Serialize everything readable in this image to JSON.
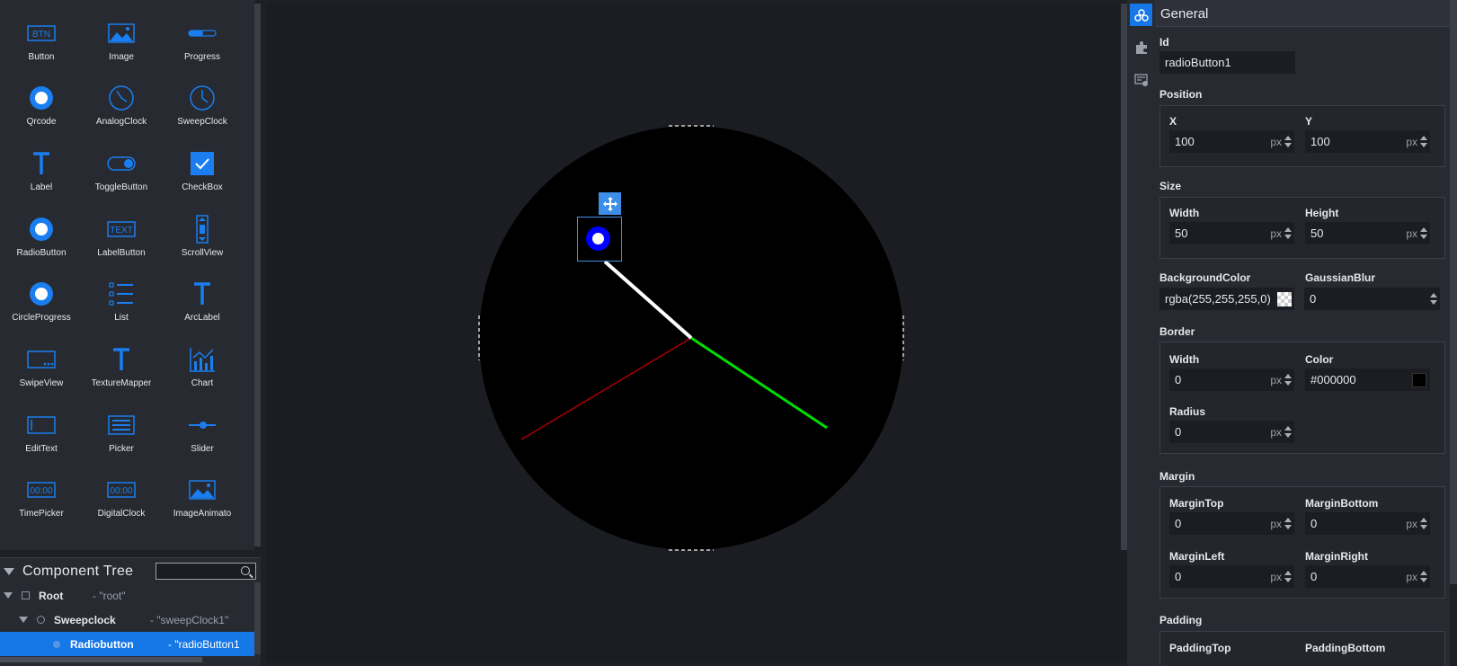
{
  "palette": {
    "items": [
      {
        "label": "Button",
        "icon": "button-icon"
      },
      {
        "label": "Image",
        "icon": "image-icon"
      },
      {
        "label": "Progress",
        "icon": "progress-icon"
      },
      {
        "label": "Qrcode",
        "icon": "qrcode-icon"
      },
      {
        "label": "AnalogClock",
        "icon": "analog-clock-icon"
      },
      {
        "label": "SweepClock",
        "icon": "sweep-clock-icon"
      },
      {
        "label": "Label",
        "icon": "label-icon"
      },
      {
        "label": "ToggleButton",
        "icon": "toggle-button-icon"
      },
      {
        "label": "CheckBox",
        "icon": "checkbox-icon"
      },
      {
        "label": "RadioButton",
        "icon": "radio-button-icon"
      },
      {
        "label": "LabelButton",
        "icon": "label-button-icon"
      },
      {
        "label": "ScrollView",
        "icon": "scroll-view-icon"
      },
      {
        "label": "CircleProgress",
        "icon": "circle-progress-icon"
      },
      {
        "label": "List",
        "icon": "list-icon"
      },
      {
        "label": "ArcLabel",
        "icon": "arc-label-icon"
      },
      {
        "label": "SwipeView",
        "icon": "swipe-view-icon"
      },
      {
        "label": "TextureMapper",
        "icon": "texture-mapper-icon"
      },
      {
        "label": "Chart",
        "icon": "chart-icon"
      },
      {
        "label": "EditText",
        "icon": "edit-text-icon"
      },
      {
        "label": "Picker",
        "icon": "picker-icon"
      },
      {
        "label": "Slider",
        "icon": "slider-icon"
      },
      {
        "label": "TimePicker",
        "icon": "time-picker-icon"
      },
      {
        "label": "DigitalClock",
        "icon": "digital-clock-icon"
      },
      {
        "label": "ImageAnimato",
        "icon": "image-animator-icon"
      }
    ],
    "btn_glyph": "BTN",
    "text_glyph": "TEXT",
    "time_glyph": "00:00"
  },
  "tree": {
    "title": "Component Tree",
    "search_placeholder": "",
    "rows": [
      {
        "name": "Root",
        "id": "- \"root\""
      },
      {
        "name": "Sweepclock",
        "id": "- \"sweepClock1\""
      },
      {
        "name": "Radiobutton",
        "id": "- \"radioButton1"
      }
    ]
  },
  "props": {
    "title": "General",
    "id_label": "Id",
    "id_value": "radioButton1",
    "position_label": "Position",
    "x_label": "X",
    "x_value": "100",
    "y_label": "Y",
    "y_value": "100",
    "size_label": "Size",
    "width_label": "Width",
    "width_value": "50",
    "height_label": "Height",
    "height_value": "50",
    "bgcolor_label": "BackgroundColor",
    "bgcolor_value": "rgba(255,255,255,0)",
    "blur_label": "GaussianBlur",
    "blur_value": "0",
    "border_label": "Border",
    "border_width_label": "Width",
    "border_width_value": "0",
    "border_color_label": "Color",
    "border_color_value": "#000000",
    "radius_label": "Radius",
    "radius_value": "0",
    "margin_label": "Margin",
    "margin_top_label": "MarginTop",
    "margin_top_value": "0",
    "margin_bottom_label": "MarginBottom",
    "margin_bottom_value": "0",
    "margin_left_label": "MarginLeft",
    "margin_left_value": "0",
    "margin_right_label": "MarginRight",
    "margin_right_value": "0",
    "padding_label": "Padding",
    "padding_top_label": "PaddingTop",
    "padding_bottom_label": "PaddingBottom",
    "unit": "px"
  },
  "colors": {
    "accent": "#1677e6",
    "hour_hand": "#ffffff",
    "minute_hand": "#00dd00",
    "second_hand": "#aa0000",
    "radio": "#0000ff"
  }
}
